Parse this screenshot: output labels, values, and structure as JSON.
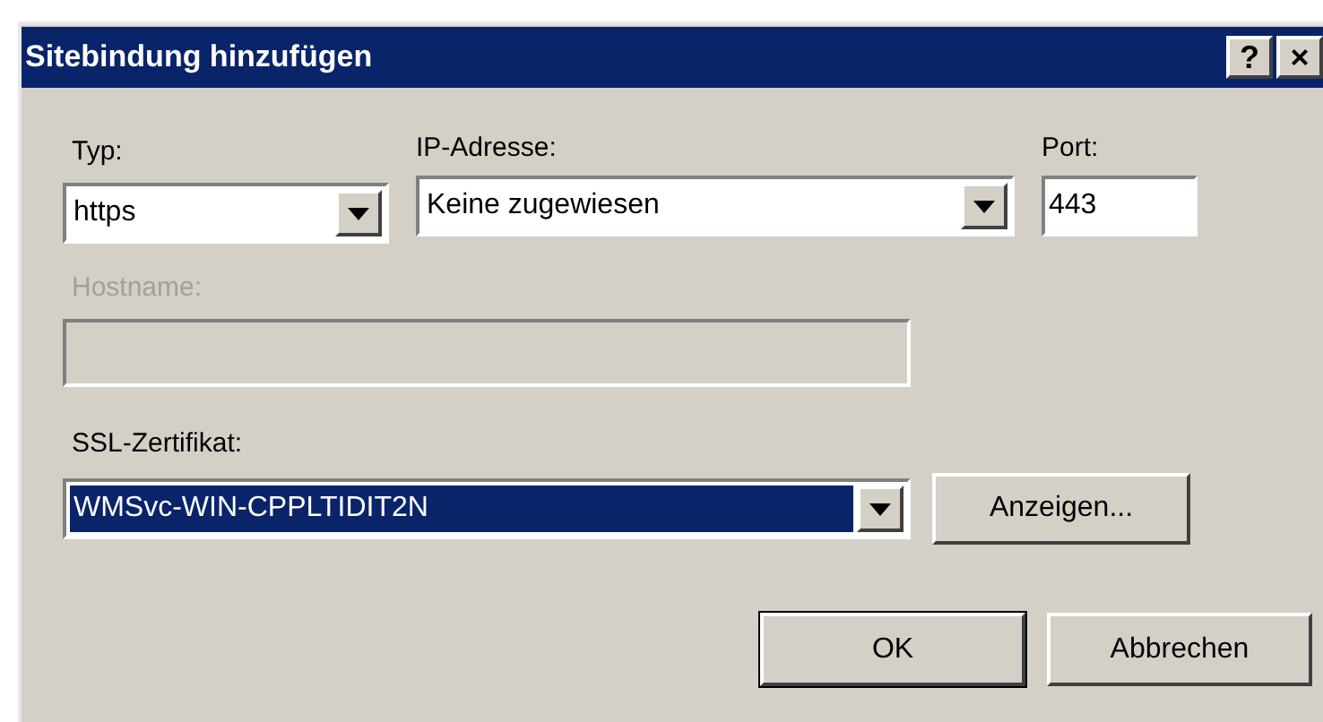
{
  "window": {
    "title": "Sitebindung hinzufügen",
    "title_buttons": [
      "?",
      "×"
    ]
  },
  "type": {
    "label": "Typ:",
    "value": "https",
    "disabled": false
  },
  "ip_address": {
    "label": "IP-Adresse:",
    "value": "Keine zugewiesen",
    "disabled": false
  },
  "port": {
    "label": "Port:",
    "value": "443",
    "disabled": false
  },
  "hostname": {
    "label": "Hostname:",
    "disabled": true
  },
  "ssl_certificate": {
    "label": "SSL-Zertifikat:",
    "value": "WMSvc-WIN-CPPLTIDIT2N",
    "selected": true,
    "view_button": "Anzeigen..."
  },
  "buttons": [
    {
      "label": "OK",
      "default": true
    },
    {
      "label": "Abbrechen",
      "default": false
    }
  ]
}
